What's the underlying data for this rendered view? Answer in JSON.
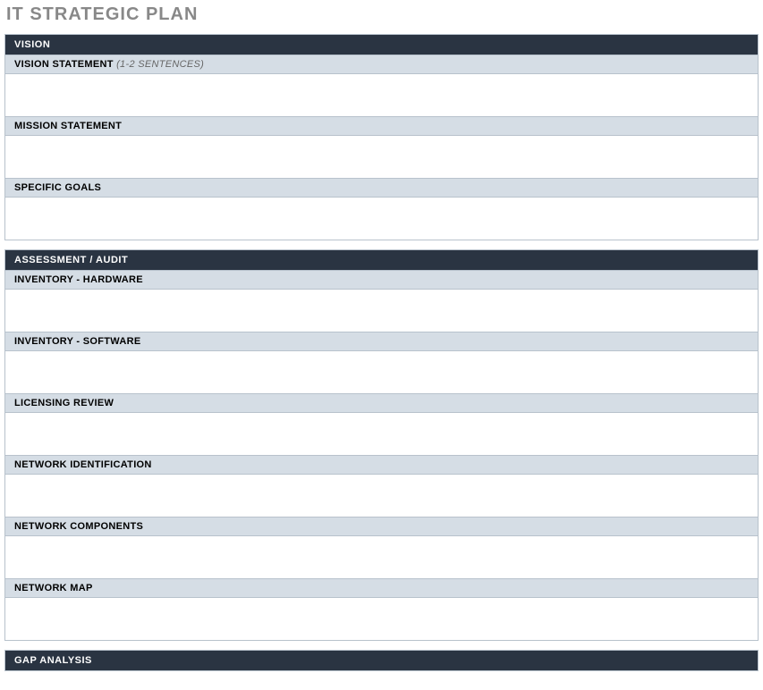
{
  "title": "IT STRATEGIC PLAN",
  "sections": [
    {
      "header": "VISION",
      "subs": [
        {
          "label": "VISION STATEMENT",
          "hint": "(1-2 SENTENCES)",
          "content": ""
        },
        {
          "label": "MISSION STATEMENT",
          "hint": "",
          "content": ""
        },
        {
          "label": "SPECIFIC GOALS",
          "hint": "",
          "content": ""
        }
      ]
    },
    {
      "header": "ASSESSMENT / AUDIT",
      "subs": [
        {
          "label": "INVENTORY - HARDWARE",
          "hint": "",
          "content": ""
        },
        {
          "label": "INVENTORY - SOFTWARE",
          "hint": "",
          "content": ""
        },
        {
          "label": "LICENSING REVIEW",
          "hint": "",
          "content": ""
        },
        {
          "label": "NETWORK IDENTIFICATION",
          "hint": "",
          "content": ""
        },
        {
          "label": "NETWORK COMPONENTS",
          "hint": "",
          "content": ""
        },
        {
          "label": "NETWORK MAP",
          "hint": "",
          "content": ""
        }
      ]
    },
    {
      "header": "GAP ANALYSIS",
      "subs": []
    }
  ]
}
